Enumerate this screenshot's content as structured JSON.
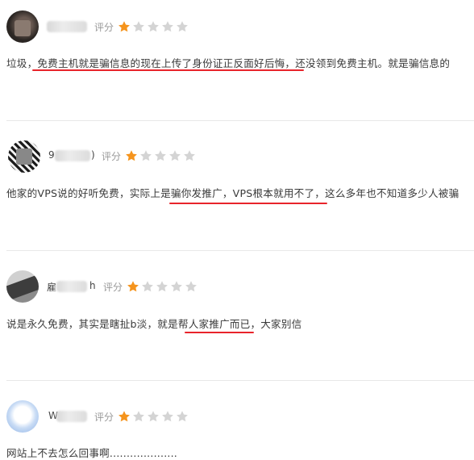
{
  "reviews": [
    {
      "username_visible": "",
      "username_tail": "",
      "rating_label": "评分",
      "rating": 1,
      "max_rating": 5,
      "comment": "垃圾，免费主机就是骗信息的现在上传了身份证正反面好后悔，还没领到免费主机。就是骗信息的"
    },
    {
      "username_visible": "9",
      "username_tail": ")",
      "rating_label": "评分",
      "rating": 1,
      "max_rating": 5,
      "comment": "他家的VPS说的好听免费，实际上是骗你发推广，VPS根本就用不了，这么多年也不知道多少人被骗"
    },
    {
      "username_visible": "雇",
      "username_tail": "h",
      "rating_label": "评分",
      "rating": 1,
      "max_rating": 5,
      "comment": "说是永久免费，其实是瞎扯b淡，就是帮人家推广而已，大家别信"
    },
    {
      "username_visible": "W",
      "username_tail": "",
      "rating_label": "评分",
      "rating": 1,
      "max_rating": 5,
      "comment": "网站上不去怎么回事啊...................."
    }
  ],
  "colors": {
    "star_filled": "#f5941d",
    "star_empty": "#d4d4d4",
    "underline": "#e8242b"
  },
  "icons": {
    "star": "star-icon",
    "avatar": "user-avatar"
  }
}
